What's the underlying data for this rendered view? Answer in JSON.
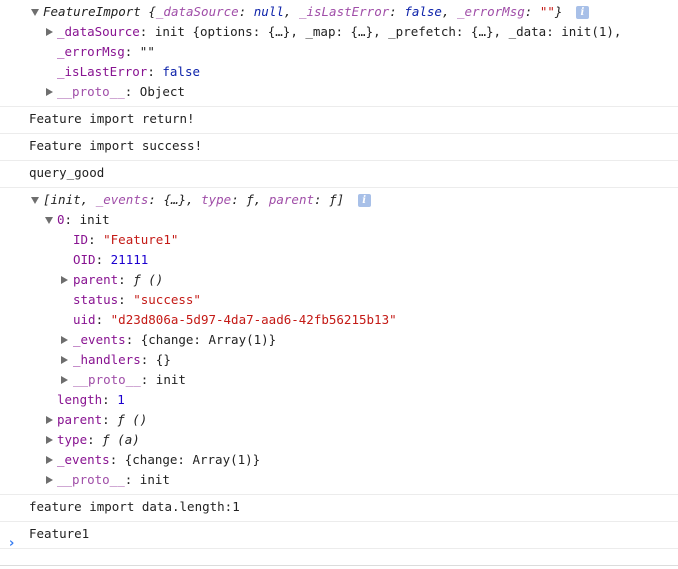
{
  "messages": [
    {
      "header": {
        "name": "FeatureImport",
        "open": " {",
        "k1": "_dataSource",
        "v1": "null",
        "k2": "_isLastError",
        "v2": "false",
        "k3": "_errorMsg",
        "v3": "\"\"",
        "close": "}"
      },
      "info": "i",
      "rows": [
        {
          "key": "_dataSource",
          "value": "init {options: {…}, _map: {…}, _prefetch: {…}, _data: init(1),"
        },
        {
          "key": "_errorMsg",
          "value": "\"\""
        },
        {
          "key": "_isLastError",
          "value": "false"
        },
        {
          "key": "__proto__",
          "value": "Object"
        }
      ]
    },
    {
      "text": "Feature import return!"
    },
    {
      "text": "Feature import success!"
    },
    {
      "text": "query_good"
    },
    {
      "header": {
        "open": "[init, ",
        "k1": "_events",
        "v1": "{…}",
        "k2": "type",
        "v2": "ƒ",
        "k3": "parent",
        "v3": "ƒ",
        "close": "]"
      },
      "info": "i",
      "item0": {
        "key": "0",
        "value": "init"
      },
      "item0_rows": [
        {
          "key": "ID",
          "value": "\"Feature1\""
        },
        {
          "key": "OID",
          "value": "21111"
        },
        {
          "key": "parent",
          "value": "ƒ ()"
        },
        {
          "key": "status",
          "value": "\"success\""
        },
        {
          "key": "uid",
          "value": "\"d23d806a-5d97-4da7-aad6-42fb56215b13\""
        },
        {
          "key": "_events",
          "value": "{change: Array(1)}"
        },
        {
          "key": "_handlers",
          "value": "{}"
        },
        {
          "key": "__proto__",
          "value": "init"
        }
      ],
      "rows": [
        {
          "key": "length",
          "value": "1"
        },
        {
          "key": "parent",
          "value": "ƒ ()"
        },
        {
          "key": "type",
          "value": "ƒ (a)"
        },
        {
          "key": "_events",
          "value": "{change: Array(1)}"
        },
        {
          "key": "__proto__",
          "value": "init"
        }
      ]
    },
    {
      "text": "feature import data.length:1"
    },
    {
      "text": "Feature1"
    }
  ],
  "prompt": {
    "caret": "›"
  },
  "colors": {
    "key": "#881391",
    "string": "#c41a16",
    "number": "#1c00cf",
    "boolean": "#0d22aa",
    "prompt": "#367cf1"
  }
}
